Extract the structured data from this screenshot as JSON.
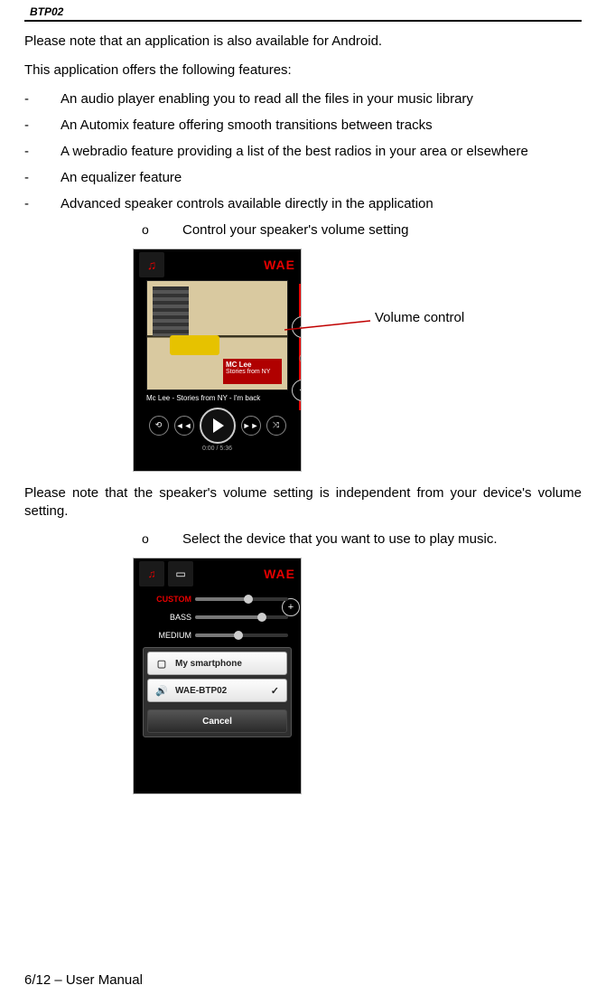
{
  "header": {
    "product": "BTP02"
  },
  "paragraphs": {
    "p1": "Please note that an application is also available for Android.",
    "p2": "This application offers the following features:",
    "note_volume": "Please note that the speaker's volume setting is independent from your device's volume setting."
  },
  "bullets": [
    "An audio player enabling you to read all the files in your music library",
    "An Automix feature offering smooth transitions between tracks",
    "A webradio feature providing a list of the best radios in your area or elsewhere",
    "An equalizer feature",
    "Advanced speaker controls available directly in the application"
  ],
  "sub_bullets": {
    "s1": "Control your speaker's volume setting",
    "s2": "Select the device that you want to use to play music."
  },
  "callouts": {
    "volume_control": "Volume control"
  },
  "screenshot1": {
    "brand": "WAE",
    "album_line1": "MC Lee",
    "album_line2": "Stories from NY",
    "track_title": "Mc Lee - Stories from NY - I'm back",
    "time": "0:00 / 5:36"
  },
  "screenshot2": {
    "brand": "WAE",
    "eq": {
      "custom": "CUSTOM",
      "bass": "BASS",
      "medium": "MEDIUM"
    },
    "menu": {
      "item1": "My smartphone",
      "item2": "WAE-BTP02",
      "cancel": "Cancel"
    }
  },
  "footer": "6/12 – User Manual"
}
